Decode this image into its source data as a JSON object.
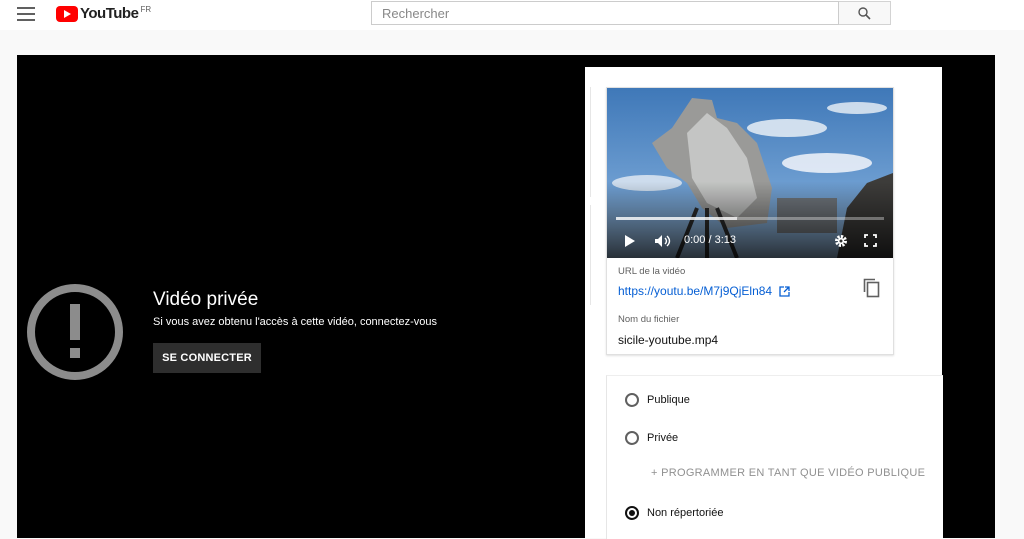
{
  "header": {
    "logo_text": "YouTube",
    "region": "FR",
    "search_placeholder": "Rechercher"
  },
  "player": {
    "title": "Vidéo privée",
    "subtitle": "Si vous avez obtenu l'accès à cette vidéo, connectez-vous",
    "signin_label": "SE CONNECTER"
  },
  "details": {
    "time": "0:00 / 3:13",
    "url_label": "URL de la vidéo",
    "url": "https://youtu.be/M7j9QjEln84",
    "filename_label": "Nom du fichier",
    "filename": "sicile-youtube.mp4"
  },
  "visibility": {
    "options": [
      {
        "label": "Publique",
        "selected": false
      },
      {
        "label": "Privée",
        "selected": false
      },
      {
        "label": "Non répertoriée",
        "selected": true
      }
    ],
    "schedule_label": "+ PROGRAMMER EN TANT QUE VIDÉO PUBLIQUE"
  },
  "colors": {
    "brand_red": "#ff0000",
    "link_blue": "#065fd4",
    "player_bg": "#000000"
  }
}
